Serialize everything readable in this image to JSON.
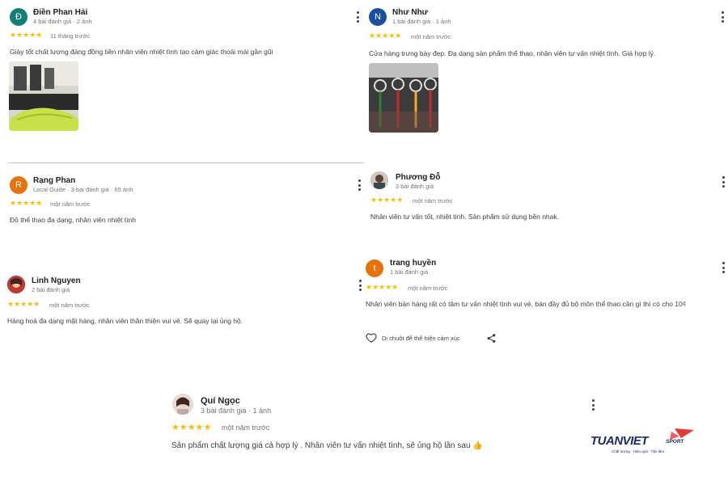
{
  "reviews": [
    {
      "name": "Điền Phan Hải",
      "meta": "4 bài đánh giá · 2 ảnh",
      "stars": "★★★★★",
      "time": "11 tháng trước",
      "text": "Giày tốt chất lượng đáng đồng tiền nhân viên nhiệt tình tạo cảm giác thoải mái gần gũi",
      "initial": "Đ",
      "avatar_color": "#0f7f78"
    },
    {
      "name": "Như Như",
      "meta": "1 bài đánh giá · 1 ảnh",
      "stars": "★★★★★",
      "time": "một năm trước",
      "text": "Cửa hàng trưng bày đẹp. Đa dạng sản phẩm thể thao, nhân viên tư vấn nhiệt tình. Giá hợp lý.",
      "initial": "N",
      "avatar_color": "#1a4fa0"
    },
    {
      "name": "Rạng Phan",
      "meta": "Local Guide · 3 bài đánh giá · 65 ảnh",
      "stars": "★★★★★",
      "time": "một năm trước",
      "text": "Đồ thể thao đa dạng, nhân viên nhiệt tình",
      "initial": "R",
      "avatar_color": "#e8710a"
    },
    {
      "name": "Phương Đỗ",
      "meta": "3 bài đánh giá",
      "stars": "★★★★★",
      "time": "một năm trước",
      "text": "Nhân viên tư vấn tốt, nhiệt tình. Sản phẩm sử dụng bền nhak."
    },
    {
      "name": "Linh Nguyen",
      "meta": "2 bài đánh giá",
      "stars": "★★★★★",
      "time": "một năm trước",
      "text": "Hàng hoá đa dạng mặt hàng, nhân viên thân thiện vui vẻ. Sẽ quay lại ủng hộ."
    },
    {
      "name": "trang huyền",
      "meta": "1 bài đánh giá",
      "stars": "★★★★★",
      "time": "một năm trước",
      "text": "Nhân viên bán hàng rất có tâm tư vấn nhiệt tình vui vẻ, bán đầy đủ bộ môn thể thao cần gì thì có cho 10₫",
      "initial": "t",
      "avatar_color": "#e8710a",
      "reaction_label": "Di chuột để thể hiện cảm xúc"
    },
    {
      "name": "Quí Ngọc",
      "meta": "3 bài đánh giá · 1 ảnh",
      "stars": "★★★★★",
      "time": "một năm trước",
      "text": "Sản phẩm chất lượng giá cả hợp lý . Nhân viên tư vấn nhiệt tình, sẽ ủng hộ lần sau 👍"
    }
  ],
  "logo": {
    "brand": "TUANVIET",
    "suffix": "SPORT",
    "tagline": "Chất lượng · Hiệu quả · Tận tâm",
    "color": "#1d2a6b",
    "accent": "#e53935"
  }
}
